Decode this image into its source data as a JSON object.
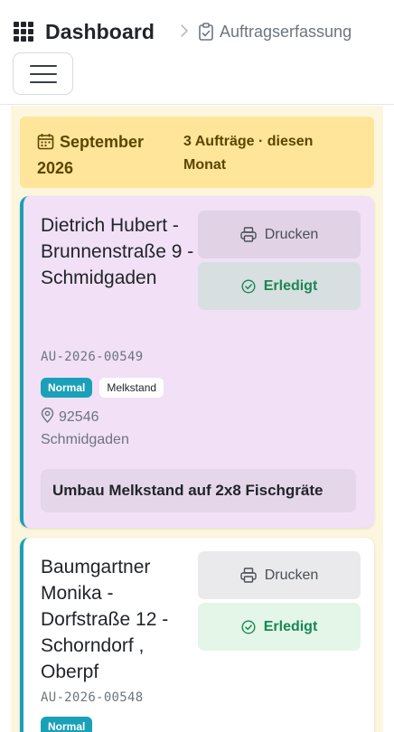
{
  "header": {
    "title": "Dashboard",
    "breadcrumb": "Auftragserfassung"
  },
  "month_banner": {
    "month": "September",
    "year": "2026",
    "count_prefix": "3 Aufträge · ",
    "count_suffix": "diesen Monat"
  },
  "orders": [
    {
      "title": "Dietrich Hubert - Brunnenstraße 9 - Schmidgaden",
      "number": "AU-2026-00549",
      "priority": "Normal",
      "category": "Melkstand",
      "postal_code": "92546",
      "city": "Schmidgaden",
      "description": "Umbau Melkstand auf 2x8 Fischgräte",
      "print_label": "Drucken",
      "done_label": "Erledigt"
    },
    {
      "title": "Baumgartner Monika - Dorfstraße 12 - Schorndorf , Oberpf",
      "number": "AU-2026-00548",
      "priority": "Normal",
      "print_label": "Drucken",
      "done_label": "Erledigt"
    }
  ],
  "colors": {
    "accent": "#1aa0b8",
    "banner": "#ffe59a",
    "success": "#198754",
    "card_highlight": "#f1e0f6"
  },
  "icons": [
    "grid-icon",
    "chevron-right-icon",
    "clipboard-check-icon",
    "menu-icon",
    "calendar-icon",
    "printer-icon",
    "check-circle-icon",
    "map-pin-icon"
  ]
}
